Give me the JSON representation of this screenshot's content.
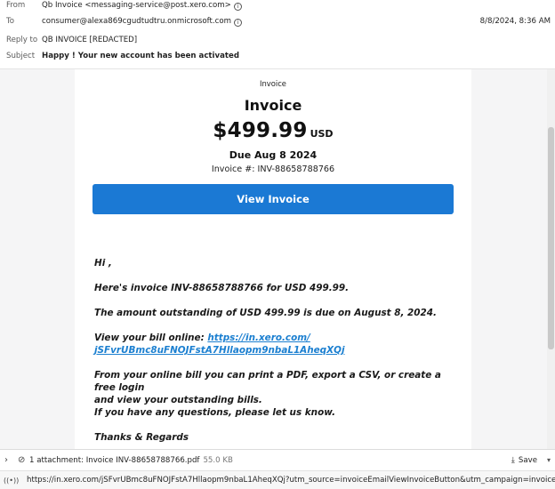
{
  "header": {
    "from_label": "From",
    "from_value": "Qb Invoice <messaging-service@post.xero.com>",
    "to_label": "To",
    "to_value": "consumer@alexa869cgudtudtru.onmicrosoft.com",
    "date": "8/8/2024, 8:36 AM",
    "reply_to_label": "Reply to",
    "reply_to_value": "QB INVOICE [REDACTED]",
    "subject_label": "Subject",
    "subject_value": "Happy ! Your new account has been activated"
  },
  "invoice": {
    "top_label": "Invoice",
    "title": "Invoice",
    "amount": "$499.99",
    "currency": "USD",
    "due": "Due Aug 8 2024",
    "number": "Invoice #: INV-88658788766",
    "button": "View Invoice"
  },
  "body": {
    "greeting": "Hi ,",
    "line1": "Here's invoice INV-88658788766 for USD 499.99.",
    "line2": "The amount outstanding of USD 499.99 is due on August 8, 2024.",
    "view_prefix": "View your bill online: ",
    "link_part1": "https://in.xero.com/",
    "link_part2": "jSFvrUBmc8uFNOJFstA7Hllaopm9nbaL1AheqXQj",
    "line4a": "From your online bill you can print a PDF, export a CSV, or create a free login",
    "line4b": "and view your outstanding bills.",
    "line5": "If you have any questions, please let us know.",
    "closing": "Thanks & Regards"
  },
  "attachment": {
    "text": "1 attachment: Invoice INV-88658788766.pdf",
    "size": "55.0 KB",
    "save": "Save"
  },
  "status": {
    "url": "https://in.xero.com/jSFvrUBmc8uFNOJFstA7Hllaopm9nbaL1AheqXQj?utm_source=invoiceEmailViewInvoiceButton&utm_campaign=invoicesEmail"
  },
  "colors": {
    "button": "#1b79d4",
    "link": "#1b7fd0",
    "background": "#f5f5f6"
  },
  "icons": [
    "info-icon",
    "chevron-right-icon",
    "paperclip-icon",
    "download-icon",
    "chevron-down-icon",
    "connection-icon"
  ]
}
